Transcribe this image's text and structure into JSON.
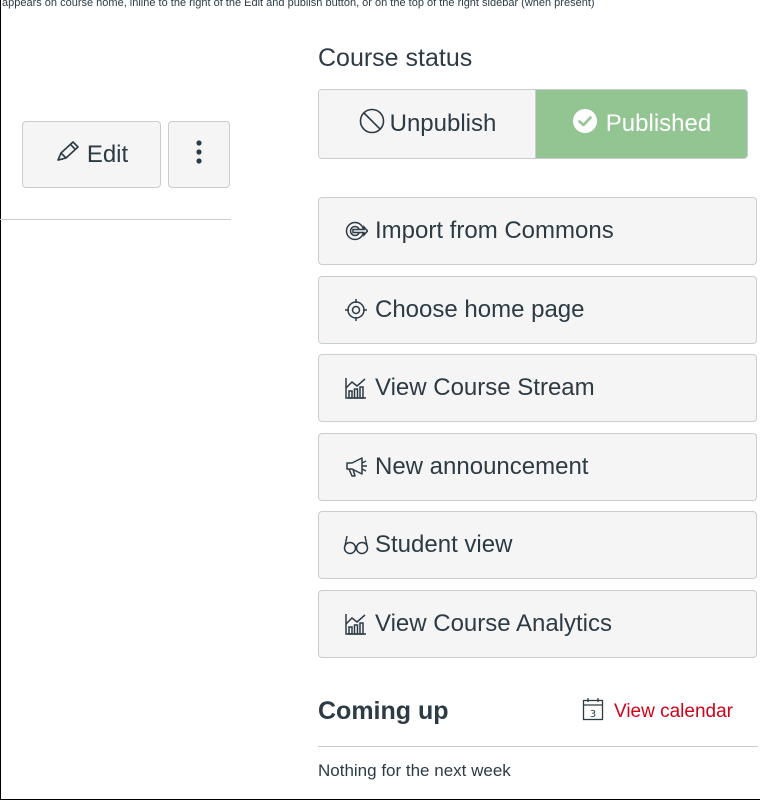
{
  "caption": "appears on course home, inline to the right of the Edit and publish button, or on the top of the right sidebar (when present)",
  "header": {
    "edit_label": "Edit"
  },
  "sidebar": {
    "status_heading": "Course status",
    "unpublish_label": "Unpublish",
    "published_label": "Published",
    "actions": [
      {
        "label": "Import from Commons",
        "icon": "commons-icon"
      },
      {
        "label": "Choose home page",
        "icon": "target-icon"
      },
      {
        "label": "View Course Stream",
        "icon": "analytics-icon"
      },
      {
        "label": "New announcement",
        "icon": "megaphone-icon"
      },
      {
        "label": "Student view",
        "icon": "glasses-icon"
      },
      {
        "label": "View Course Analytics",
        "icon": "analytics-icon"
      }
    ],
    "coming_up": {
      "heading": "Coming up",
      "calendar_link": "View calendar",
      "calendar_day": "3",
      "empty_text": "Nothing for the next week"
    }
  },
  "colors": {
    "published_bg": "#93c592",
    "link_red": "#d0021b",
    "button_bg": "#f5f5f5",
    "border": "#c7cdd1",
    "text": "#2d3b45"
  }
}
